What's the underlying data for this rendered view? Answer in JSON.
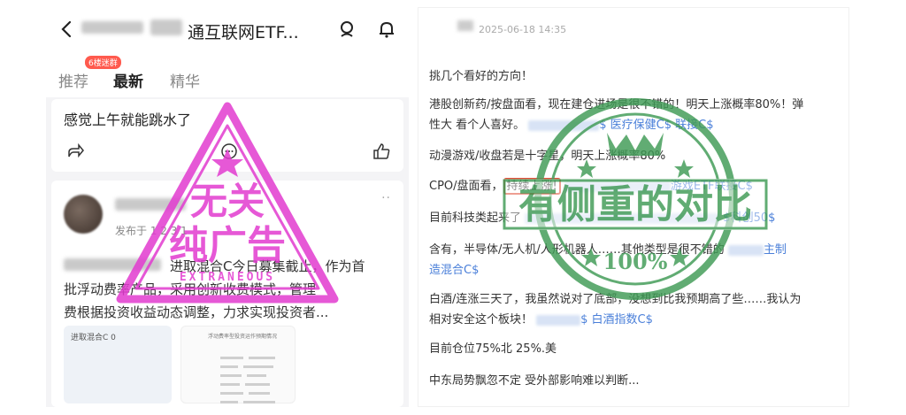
{
  "left": {
    "header": {
      "title": "通互联网ETF..."
    },
    "tabs": [
      {
        "label": "推荐"
      },
      {
        "label": "最新"
      },
      {
        "label": "精华"
      }
    ],
    "tab_badge": "6楼迷群",
    "post1": {
      "text": "感觉上午就能跳水了"
    },
    "post2": {
      "published": "发布于 1  2  3 1",
      "body_line1": "进取混合C今日募集截止，作为首",
      "body_line2": "批浮动费率产品，采用创新收费模式，管理",
      "body_line3": "费根据投资收益动态调整，力求实现投资者...",
      "more": "··",
      "thumb_a_caption": "进取混合C 0",
      "thumb_b_caption": "浮动费率型投资运作预期情况"
    },
    "stamp": {
      "line1": "无关",
      "line2": "纯广告",
      "sub": "EXTRANEOUS"
    }
  },
  "right": {
    "timestamp": "2025-06-18 14:35",
    "p1": "挑几个看好的方向！",
    "p2_line1": "港股创新药/按盘面看，现在建仓进场是很不错的！明天上涨概率80%！弹",
    "p2_line2a": "性大 看个人喜好。",
    "p2_link": "$ 医疗保健C$ 联接C$",
    "p3": "动漫游戏/收盘若是十字星，明天上涨概率80%",
    "p4_pre": "CPO/盘面看，",
    "p4_highlight": "持续上涨!",
    "p4_link": "游戏ETF联接C$",
    "p5_pre": "目前科技类起来了",
    "p5_link": "$科创50$",
    "p6_line1": "含有，半导体/无人机/人形机器人……其他类型是很不错的",
    "p6_link1": "主制",
    "p6_link2": "造混合C$",
    "p7_line1": "白酒/连涨三天了，我虽然说对了底部，没想到比我预期高了些……我认为",
    "p7_line2a": "相对安全这个板块！",
    "p7_link": "$ 白酒指数C$",
    "p8": "目前仓位75%北 25%.美",
    "p9": "中东局势飘忽不定 受外部影响难以判断...",
    "stamp": {
      "text": "有侧重的对比",
      "percent": "100%"
    }
  },
  "colors": {
    "stamp_magenta": "#e23bd0",
    "stamp_green": "#3f9a55",
    "link_blue": "#4a7fd9",
    "highlight_red": "#e0503a"
  }
}
